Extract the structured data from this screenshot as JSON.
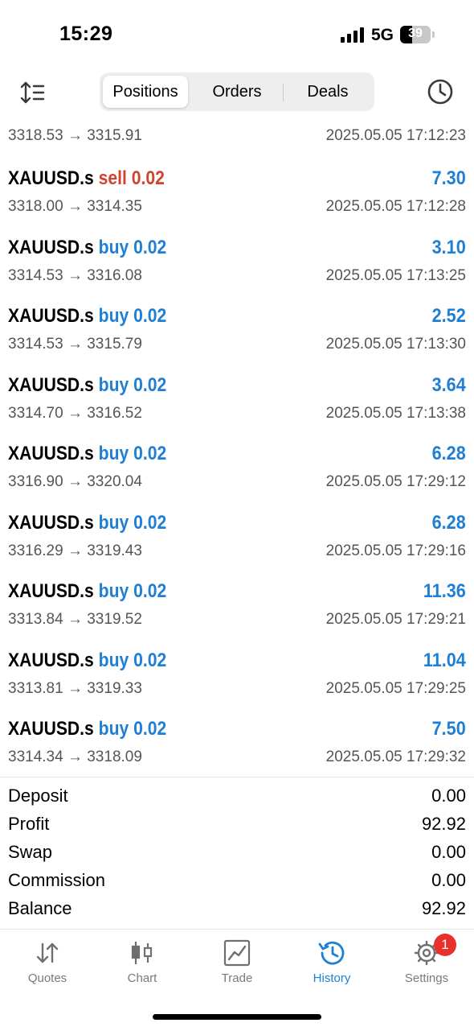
{
  "status_bar": {
    "time": "15:29",
    "network": "5G",
    "battery": "39",
    "battery_level": 0.39
  },
  "toolbar": {
    "tabs": [
      {
        "label": "Positions",
        "active": true
      },
      {
        "label": "Orders",
        "active": false
      },
      {
        "label": "Deals",
        "active": false
      }
    ]
  },
  "partial_row": {
    "prices": "3318.53 → 3315.91",
    "time": "2025.05.05 17:12:23"
  },
  "deals": [
    {
      "symbol": "XAUUSD.s",
      "side": "sell 0.02",
      "type": "sell",
      "profit": "7.30",
      "prices": "3318.00 → 3314.35",
      "time": "2025.05.05 17:12:28"
    },
    {
      "symbol": "XAUUSD.s",
      "side": "buy 0.02",
      "type": "buy",
      "profit": "3.10",
      "prices": "3314.53 → 3316.08",
      "time": "2025.05.05 17:13:25"
    },
    {
      "symbol": "XAUUSD.s",
      "side": "buy 0.02",
      "type": "buy",
      "profit": "2.52",
      "prices": "3314.53 → 3315.79",
      "time": "2025.05.05 17:13:30"
    },
    {
      "symbol": "XAUUSD.s",
      "side": "buy 0.02",
      "type": "buy",
      "profit": "3.64",
      "prices": "3314.70 → 3316.52",
      "time": "2025.05.05 17:13:38"
    },
    {
      "symbol": "XAUUSD.s",
      "side": "buy 0.02",
      "type": "buy",
      "profit": "6.28",
      "prices": "3316.90 → 3320.04",
      "time": "2025.05.05 17:29:12"
    },
    {
      "symbol": "XAUUSD.s",
      "side": "buy 0.02",
      "type": "buy",
      "profit": "6.28",
      "prices": "3316.29 → 3319.43",
      "time": "2025.05.05 17:29:16"
    },
    {
      "symbol": "XAUUSD.s",
      "side": "buy 0.02",
      "type": "buy",
      "profit": "11.36",
      "prices": "3313.84 → 3319.52",
      "time": "2025.05.05 17:29:21"
    },
    {
      "symbol": "XAUUSD.s",
      "side": "buy 0.02",
      "type": "buy",
      "profit": "11.04",
      "prices": "3313.81 → 3319.33",
      "time": "2025.05.05 17:29:25"
    },
    {
      "symbol": "XAUUSD.s",
      "side": "buy 0.02",
      "type": "buy",
      "profit": "7.50",
      "prices": "3314.34 → 3318.09",
      "time": "2025.05.05 17:29:32"
    }
  ],
  "summary": [
    {
      "label": "Deposit",
      "value": "0.00"
    },
    {
      "label": "Profit",
      "value": "92.92"
    },
    {
      "label": "Swap",
      "value": "0.00"
    },
    {
      "label": "Commission",
      "value": "0.00"
    },
    {
      "label": "Balance",
      "value": "92.92"
    }
  ],
  "tabbar": {
    "items": [
      {
        "label": "Quotes",
        "icon": "quotes-icon"
      },
      {
        "label": "Chart",
        "icon": "chart-icon"
      },
      {
        "label": "Trade",
        "icon": "trade-icon"
      },
      {
        "label": "History",
        "icon": "history-icon",
        "active": true
      },
      {
        "label": "Settings",
        "icon": "settings-icon"
      }
    ],
    "settings_badge": "1"
  },
  "colors": {
    "accent": "#1e7fd4",
    "sell": "#d0432f",
    "badge": "#e8302c"
  }
}
